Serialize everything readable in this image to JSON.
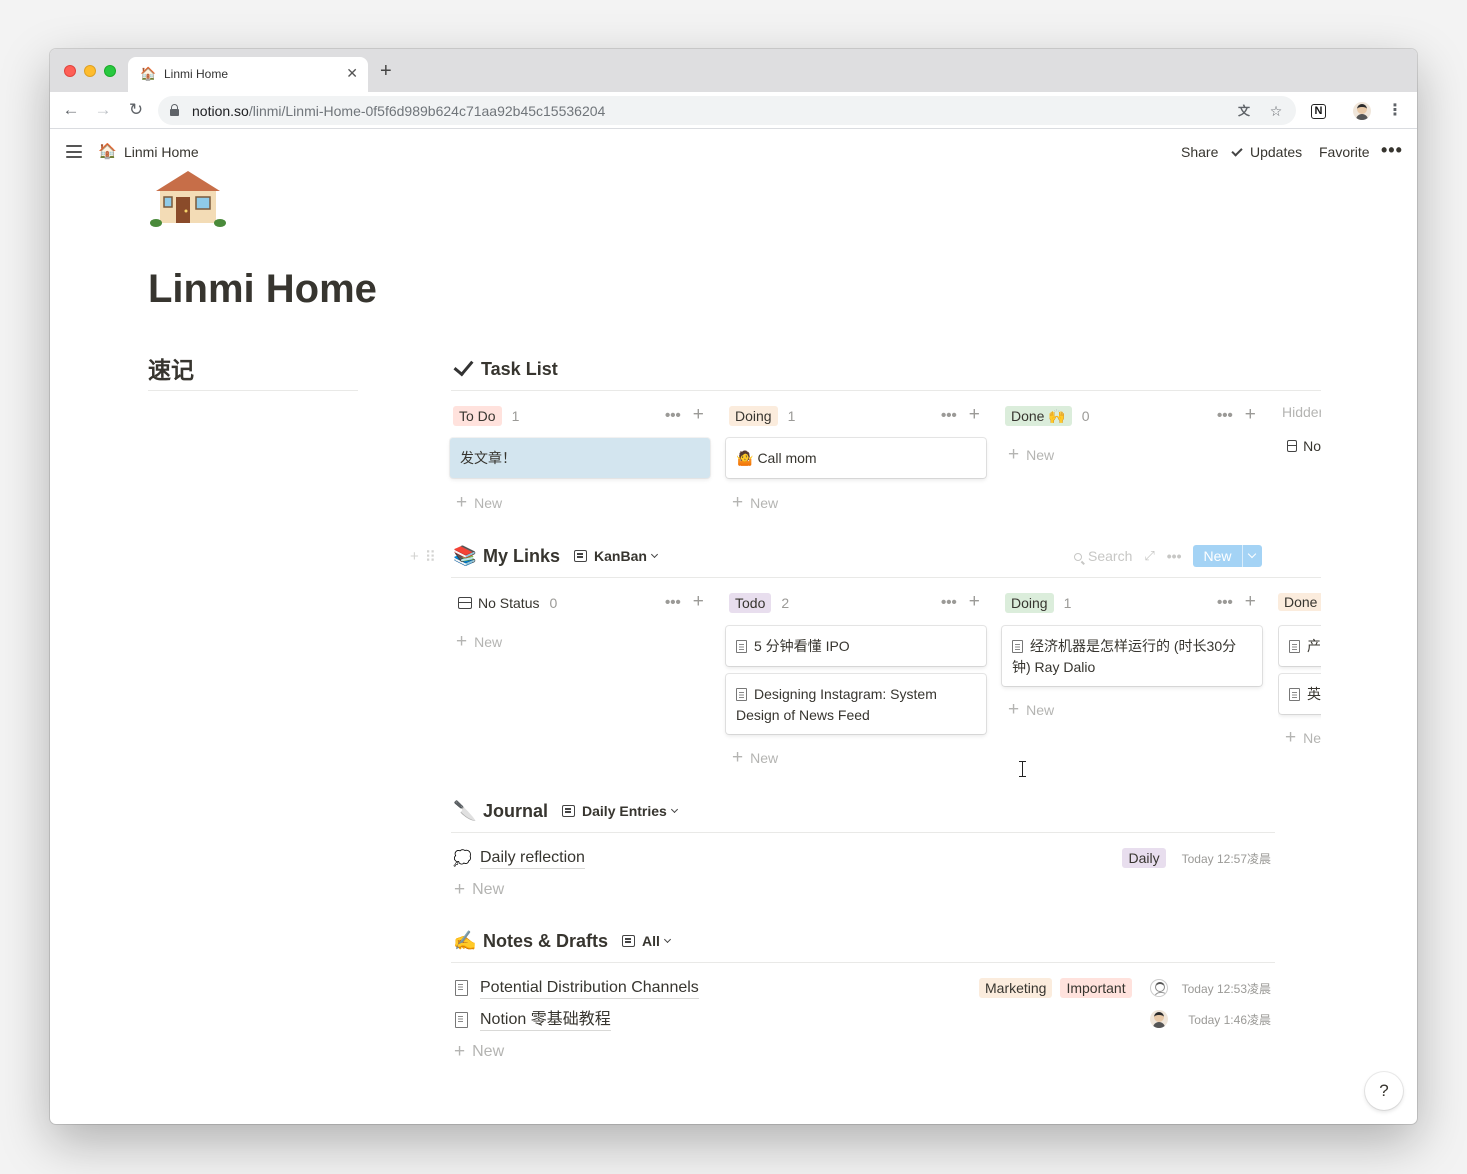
{
  "browser": {
    "tab_title": "Linmi Home",
    "tab_favicon": "🏠",
    "close_glyph": "✕",
    "newtab_glyph": "+",
    "url_host": "notion.so",
    "url_path": "/linmi/Linmi-Home-0f5f6d989b624c71aa92b45c15536204",
    "icons": [
      "back-icon",
      "forward-icon",
      "reload-icon",
      "lock-icon",
      "translate-icon",
      "star-icon",
      "notion-extension-icon",
      "profile-avatar-icon",
      "kebab-menu-icon"
    ]
  },
  "topbar": {
    "breadcrumb_icon": "🏠",
    "breadcrumb": "Linmi Home",
    "share": "Share",
    "updates": "Updates",
    "favorite": "Favorite",
    "more": "•••"
  },
  "page": {
    "icon": "🏠",
    "title": "Linmi Home",
    "left_heading": "速记"
  },
  "task_list": {
    "title": "Task List",
    "columns": [
      {
        "tag": "To Do",
        "color": "#ffe2dd",
        "count": "1",
        "cards": [
          "发文章！"
        ]
      },
      {
        "tag": "Doing",
        "color": "#fbecdd",
        "count": "1",
        "cards": [
          "Call mom"
        ],
        "card_emoji": "🤷"
      },
      {
        "tag": "Done 🙌",
        "color": "#dbeddb",
        "count": "0",
        "cards": []
      },
      {
        "tag": "Hidden",
        "hidden_item": "No"
      }
    ],
    "new_label": "New"
  },
  "my_links": {
    "emoji": "📚",
    "title": "My Links",
    "view": "KanBan",
    "search": "Search",
    "new_button": "New",
    "columns": [
      {
        "tag": "No Status",
        "count": "0",
        "cards": []
      },
      {
        "tag": "Todo",
        "color": "#e8deee",
        "count": "2",
        "cards": [
          "5 分钟看懂 IPO",
          "Designing Instagram: System Design of News Feed"
        ]
      },
      {
        "tag": "Doing",
        "color": "#dbeddb",
        "count": "1",
        "cards": [
          "经济机器是怎样运行的 (时长30分钟) Ray Dalio"
        ]
      },
      {
        "tag": "Done",
        "color": "#fbecdd",
        "cards": [
          "产",
          "英"
        ]
      }
    ],
    "new_label": "New",
    "partial_new": "Ne"
  },
  "journal": {
    "emoji": "🔪",
    "title": "Journal",
    "view": "Daily Entries",
    "rows": [
      {
        "icon": "💭",
        "title": "Daily reflection",
        "tag": "Daily",
        "tag_color": "#e8deee",
        "time": "Today 12:57凌晨"
      }
    ],
    "new_label": "New"
  },
  "notes": {
    "emoji": "✍️",
    "title": "Notes & Drafts",
    "view": "All",
    "rows": [
      {
        "title": "Potential Distribution Channels",
        "tags": [
          "Marketing",
          "Important"
        ],
        "tag_colors": [
          "#fbecdd",
          "#ffe2dd"
        ],
        "time": "Today 12:53凌晨"
      },
      {
        "title": "Notion 零基础教程",
        "tags": [],
        "time": "Today 1:46凌晨"
      }
    ],
    "new_label": "New"
  },
  "help": "?"
}
